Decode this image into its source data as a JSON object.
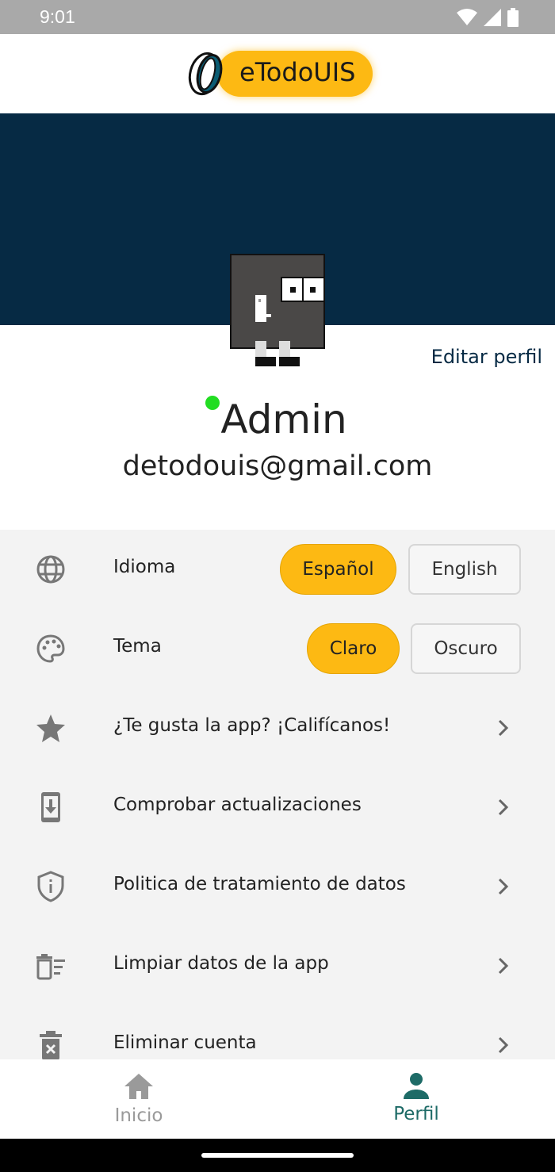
{
  "status_bar": {
    "time": "9:01"
  },
  "header": {
    "logo_text": "eTodoUIS"
  },
  "profile": {
    "edit_label": "Editar perfil",
    "name": "Admin",
    "email": "detodouis@gmail.com",
    "online": true
  },
  "settings": {
    "language": {
      "label": "Idioma",
      "options": [
        "Español",
        "English"
      ],
      "selected": "Español"
    },
    "theme": {
      "label": "Tema",
      "options": [
        "Claro",
        "Oscuro"
      ],
      "selected": "Claro"
    },
    "items": [
      {
        "label": "¿Te gusta la app? ¡Califícanos!",
        "icon": "star-icon"
      },
      {
        "label": "Comprobar actualizaciones",
        "icon": "phone-download-icon"
      },
      {
        "label": "Politica de tratamiento de datos",
        "icon": "shield-info-icon"
      },
      {
        "label": "Limpiar datos de la app",
        "icon": "delete-sweep-icon"
      },
      {
        "label": "Eliminar cuenta",
        "icon": "delete-forever-icon"
      }
    ]
  },
  "bottom_nav": {
    "items": [
      {
        "label": "Inicio",
        "icon": "home-icon",
        "active": false
      },
      {
        "label": "Perfil",
        "icon": "person-icon",
        "active": true
      }
    ]
  },
  "colors": {
    "accent": "#FDB913",
    "banner": "#062A44",
    "nav_active": "#1E6B67",
    "nav_inactive": "#9a9a9a",
    "online": "#22dd22"
  }
}
